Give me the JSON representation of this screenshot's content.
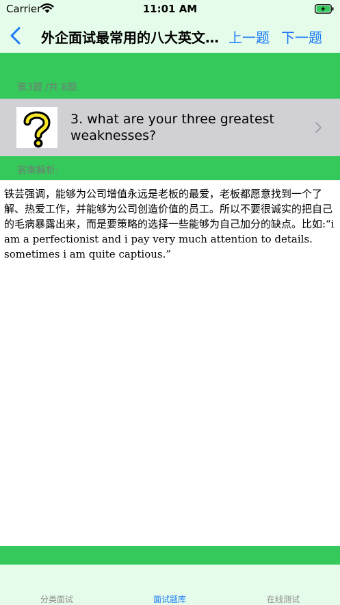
{
  "status_bar": {
    "carrier": "Carrier",
    "time": "11:01 AM"
  },
  "nav": {
    "title": "外企面试最常用的八大英文问题",
    "prev_label": "上一题",
    "next_label": "下一题"
  },
  "question": {
    "counter": "第3题 /共 8题",
    "text": "3. what are your three greatest weaknesses?",
    "icon": "question-mark-icon"
  },
  "answer": {
    "label": "答案解析:",
    "body": "铁芸强调，能够为公司增值永远是老板的最爱，老板都愿意找到一个了解、热爱工作，并能够为公司创造价值的员工。所以不要很诚实的把自己的毛病暴露出来，而是要策略的选择一些能够为自己加分的缺点。比如:“i am a perfectionist and i pay very much attention to details. sometimes i am quite captious.”"
  },
  "tabs": [
    {
      "label": "分类面试",
      "active": false
    },
    {
      "label": "面试题库",
      "active": true
    },
    {
      "label": "在线测试",
      "active": false
    }
  ],
  "colors": {
    "accent": "#1a7af8",
    "green": "#35c95c",
    "pale_green": "#e6fcea",
    "cell_gray": "#d1d1d5"
  }
}
